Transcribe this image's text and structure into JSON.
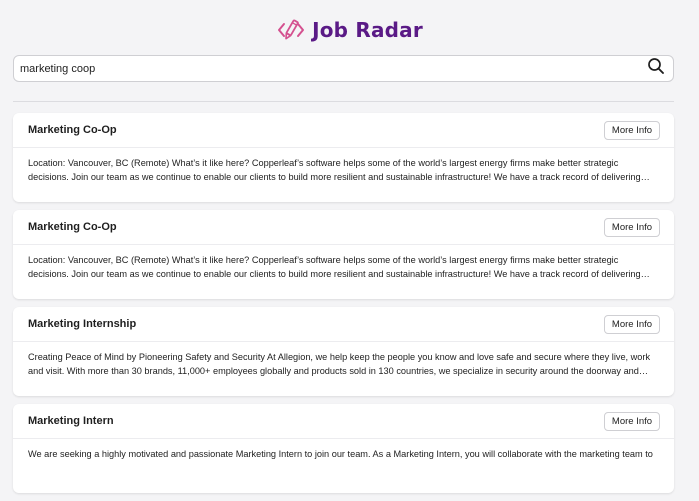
{
  "app": {
    "title": "Job Radar",
    "logo_icon": "code-pencil-icon",
    "brand_color": "#5a1a86",
    "icon_color": "#d4508f"
  },
  "search": {
    "value": "marketing coop",
    "icon": "search-icon"
  },
  "results": [
    {
      "title": "Marketing Co-Op",
      "button_label": "More Info",
      "description": "Location: Vancouver, BC (Remote) What’s it like here? Copperleaf’s software helps some of the world’s largest energy firms make better strategic decisions. Join our team as we continue to enable our clients to build more resilient and sustainable infrastructure! We have a track record of delivering award-winning,..."
    },
    {
      "title": "Marketing Co-Op",
      "button_label": "More Info",
      "description": "Location: Vancouver, BC (Remote) What’s it like here? Copperleaf’s software helps some of the world’s largest energy firms make better strategic decisions. Join our team as we continue to enable our clients to build more resilient and sustainable infrastructure! We have a track record of delivering award-winning,..."
    },
    {
      "title": "Marketing Internship",
      "button_label": "More Info",
      "description": "Creating Peace of Mind by Pioneering Safety and Security At Allegion, we help keep the people you know and love safe and secure where they live, work and visit. With more than 30 brands, 11,000+ employees globally and products sold in 130 countries, we specialize in security around the doorway and beyond...."
    },
    {
      "title": "Marketing Intern",
      "button_label": "More Info",
      "description": "We are seeking a highly motivated and passionate Marketing Intern to join our team. As a Marketing Intern, you will collaborate with the marketing team to"
    }
  ]
}
